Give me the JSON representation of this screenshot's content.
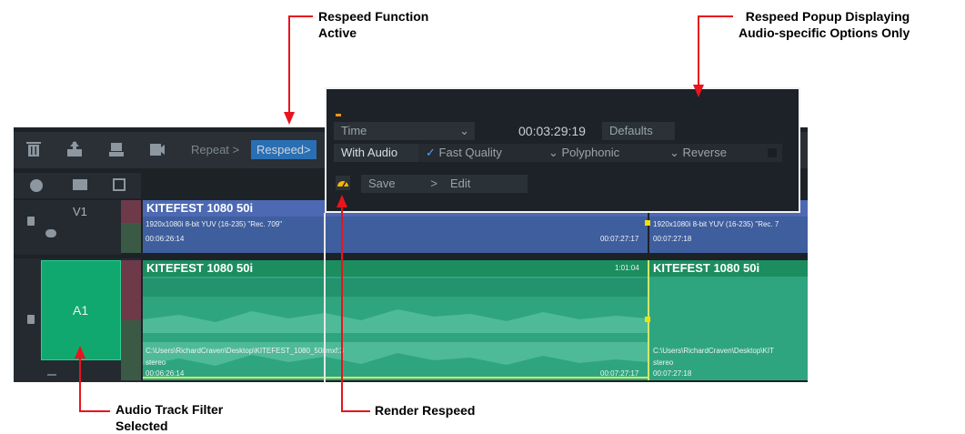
{
  "annotations": {
    "respeed_function": "Respeed Function\nActive",
    "respeed_popup": "Respeed Popup Displaying\nAudio-specific Options Only",
    "audio_track_filter": "Audio Track Filter\nSelected",
    "render_respeed": "Render Respeed"
  },
  "toolbar": {
    "repeat_label": "Repeat",
    "respeed_label": "Respeed"
  },
  "popup": {
    "mode": "Time",
    "duration": "00:03:29:19",
    "defaults": "Defaults",
    "with_audio": "With Audio",
    "fast_quality": "Fast Quality",
    "polyphonic": "Polyphonic",
    "reverse": "Reverse",
    "save": "Save",
    "edit": "Edit"
  },
  "tracks": {
    "v1_label": "V1",
    "a1_label": "A1"
  },
  "clips": {
    "v1_title": "KITEFEST 1080 50i",
    "v1_format": "1920x1080i 8-bit YUV (16-235) \"Rec. 709\"",
    "v1_in": "00:06:26:14",
    "v1_out": "00:07:27:17",
    "v1_next_format": "1920x1080i 8-bit YUV (16-235) \"Rec. 7",
    "v1_next_in": "00:07:27:18",
    "a1_title": "KITEFEST 1080 50i",
    "a1_duration": "1:01:04",
    "a1_next_title": "KITEFEST 1080 50i",
    "a1_path": "C:\\Users\\RichardCraven\\Desktop\\KITEFEST_1080_50i.mxf:3",
    "a1_channels": "stereo",
    "a1_in": "00:06:26:14",
    "a1_out": "00:07:27:17",
    "a1_next_path": "C:\\Users\\RichardCraven\\Desktop\\KIT",
    "a1_next_channels": "stereo",
    "a1_next_in": "00:07:27:18"
  },
  "colors": {
    "annotation_red": "#e8141e",
    "video_clip": "#3f5e9e",
    "audio_clip": "#2fa57f",
    "audio_track_selected": "#10a86f",
    "respeed_active": "#2a6fb3"
  }
}
